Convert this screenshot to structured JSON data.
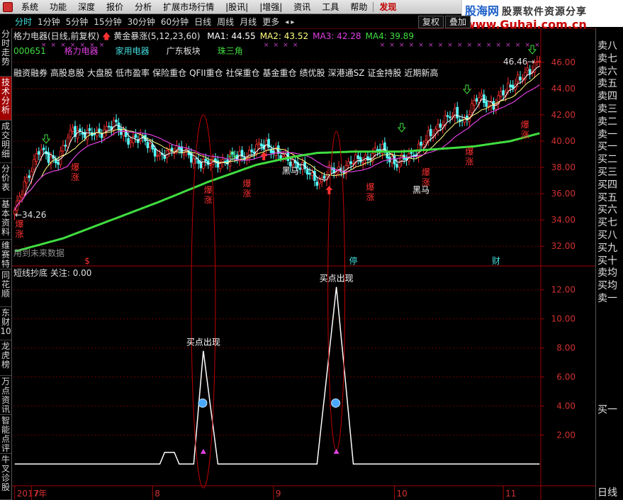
{
  "menu": {
    "items": [
      "系统",
      "功能",
      "深度",
      "报价",
      "分析",
      "扩展市场行情",
      "|股讯|",
      "|增强|",
      "资讯",
      "工具",
      "帮助"
    ],
    "highlight": "发现"
  },
  "logo": {
    "brand": "股海网",
    "slogan": "股票软件资源分享",
    "url": "www.Guhai.com.cn"
  },
  "periods": {
    "items": [
      "分时",
      "1分钟",
      "5分钟",
      "15分钟",
      "30分钟",
      "60分钟",
      "日线",
      "周线",
      "月线",
      "更多"
    ],
    "active": "分时",
    "buttons": [
      "复权",
      "叠加"
    ]
  },
  "left_tabs": [
    "分时走势",
    "技术分析",
    "成交明细",
    "分价表",
    "基本资料",
    "维赛特",
    "同花顺",
    "东财10",
    "龙虎榜",
    "万点资讯",
    "智能点评",
    "牛叉诊股"
  ],
  "left_tabs_active": "技术分析",
  "order_book": {
    "sell": [
      "卖八",
      "卖七",
      "卖六",
      "卖五",
      "卖四",
      "卖三",
      "卖二",
      "卖一"
    ],
    "buy": [
      "买一",
      "买二",
      "买三",
      "买四",
      "买五",
      "买六",
      "买七",
      "买八",
      "买九",
      "买十"
    ],
    "extra": [
      "卖均",
      "买均",
      "卖一"
    ],
    "bottom": "买一",
    "period_label": "日线"
  },
  "stock": {
    "name": "格力电器(日线,前复权)",
    "code": "000651",
    "indicator": "黄金暴涨(5,12,23,60)",
    "ma": [
      {
        "label": "MA1: 44.55",
        "color": "#ffffff"
      },
      {
        "label": "MA2: 43.52",
        "color": "#ffff80"
      },
      {
        "label": "MA3: 42.28",
        "color": "#e040e0"
      },
      {
        "label": "MA4: 39.89",
        "color": "#40dd40"
      }
    ],
    "tags": [
      {
        "label": "格力电器",
        "color": "#e040e0"
      },
      {
        "label": "家用电器",
        "color": "#44dddd"
      },
      {
        "label": "广东板块",
        "color": "#e0e0e0"
      },
      {
        "label": "珠三角",
        "color": "#40dd40"
      }
    ],
    "concepts": [
      "融资融券",
      "高股息股",
      "大盘股",
      "低市盈率",
      "保险重仓",
      "QFII重仓",
      "社保重仓",
      "基金重仓",
      "绩优股",
      "深港通SZ",
      "证金持股",
      "近期新高"
    ],
    "future_note": "用到未来数据"
  },
  "sub_indicator": {
    "title": "短线抄底",
    "focus": "关注: 0.00",
    "signal_label": "买点出现"
  },
  "annotations": {
    "price_high": "46.46",
    "price_low": "34.26",
    "surge": "爆涨",
    "black_horse": "黑马",
    "halt": "停",
    "finance": "财",
    "dividend": "$"
  },
  "chart_data": {
    "type": "line",
    "main_axis": {
      "ylim": [
        30.5,
        47.5
      ],
      "ticks": [
        32.0,
        34.0,
        36.0,
        38.0,
        40.0,
        42.0,
        44.0,
        46.0
      ]
    },
    "sub_axis": {
      "ylim": [
        -1.5,
        13.5
      ],
      "ticks": [
        2.0,
        4.0,
        6.0,
        8.0,
        10.0,
        12.0
      ]
    },
    "x_labels": [
      "2017年",
      "7",
      "8",
      "9",
      "10",
      "11"
    ],
    "x_label_index": [
      0,
      7,
      57,
      107,
      157,
      202
    ],
    "n_days": 218,
    "price_knots": [
      [
        0,
        34.5
      ],
      [
        4,
        36.8
      ],
      [
        10,
        39.2
      ],
      [
        18,
        38.5
      ],
      [
        24,
        41.0
      ],
      [
        30,
        40.4
      ],
      [
        36,
        40.8
      ],
      [
        42,
        41.2
      ],
      [
        48,
        40.0
      ],
      [
        54,
        40.2
      ],
      [
        60,
        38.6
      ],
      [
        66,
        39.6
      ],
      [
        72,
        38.8
      ],
      [
        80,
        38.2
      ],
      [
        88,
        38.6
      ],
      [
        96,
        39.0
      ],
      [
        104,
        39.8
      ],
      [
        110,
        38.8
      ],
      [
        116,
        38.4
      ],
      [
        122,
        37.4
      ],
      [
        126,
        37.0
      ],
      [
        130,
        37.6
      ],
      [
        134,
        37.8
      ],
      [
        140,
        38.4
      ],
      [
        146,
        38.8
      ],
      [
        152,
        39.4
      ],
      [
        158,
        38.2
      ],
      [
        164,
        39.0
      ],
      [
        170,
        40.0
      ],
      [
        176,
        41.4
      ],
      [
        182,
        42.0
      ],
      [
        186,
        41.6
      ],
      [
        192,
        43.4
      ],
      [
        198,
        42.6
      ],
      [
        204,
        44.2
      ],
      [
        210,
        44.8
      ],
      [
        214,
        45.6
      ],
      [
        217,
        46.4
      ]
    ],
    "ma4_knots": [
      [
        0,
        31.6
      ],
      [
        20,
        32.6
      ],
      [
        40,
        34.0
      ],
      [
        60,
        35.4
      ],
      [
        80,
        36.9
      ],
      [
        100,
        38.2
      ],
      [
        115,
        38.8
      ],
      [
        125,
        39.1
      ],
      [
        140,
        39.2
      ],
      [
        160,
        39.2
      ],
      [
        175,
        39.4
      ],
      [
        190,
        39.6
      ],
      [
        205,
        40.0
      ],
      [
        217,
        40.6
      ]
    ],
    "signal_knots": [
      [
        0,
        0
      ],
      [
        60,
        0
      ],
      [
        62,
        0.8
      ],
      [
        66,
        0.8
      ],
      [
        68,
        0
      ],
      [
        74,
        0
      ],
      [
        78,
        7.8
      ],
      [
        84,
        0
      ],
      [
        125,
        0
      ],
      [
        133,
        12.2
      ],
      [
        140,
        0
      ],
      [
        217,
        0
      ]
    ]
  }
}
